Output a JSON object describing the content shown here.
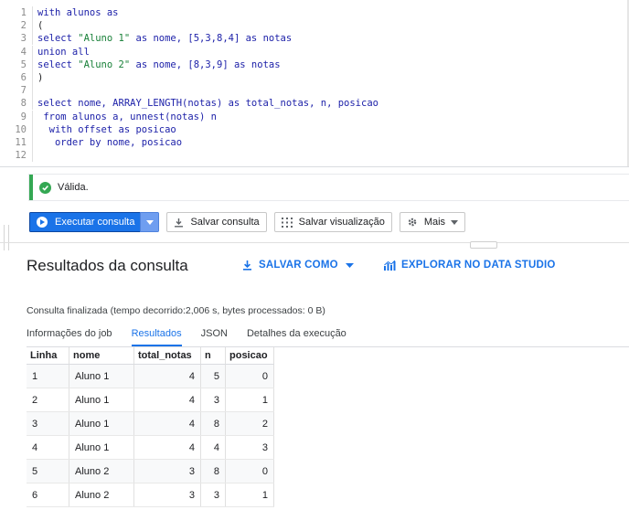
{
  "editor": {
    "lines": [
      {
        "num": "1",
        "tokens": [
          {
            "t": "with alunos as",
            "c": "kw"
          }
        ]
      },
      {
        "num": "2",
        "tokens": [
          {
            "t": "(",
            "c": "plain"
          }
        ]
      },
      {
        "num": "3",
        "tokens": [
          {
            "t": "select ",
            "c": "kw"
          },
          {
            "t": "\"Aluno 1\"",
            "c": "str"
          },
          {
            "t": " as nome, [5,3,8,4] as notas",
            "c": "kw"
          }
        ]
      },
      {
        "num": "4",
        "tokens": [
          {
            "t": "union all",
            "c": "kw"
          }
        ]
      },
      {
        "num": "5",
        "tokens": [
          {
            "t": "select ",
            "c": "kw"
          },
          {
            "t": "\"Aluno 2\"",
            "c": "str"
          },
          {
            "t": " as nome, [8,3,9] as notas",
            "c": "kw"
          }
        ]
      },
      {
        "num": "6",
        "tokens": [
          {
            "t": ")",
            "c": "plain"
          }
        ]
      },
      {
        "num": "7",
        "tokens": []
      },
      {
        "num": "8",
        "tokens": [
          {
            "t": "select nome, ARRAY_LENGTH(notas) as total_notas, n, posicao",
            "c": "kw"
          }
        ]
      },
      {
        "num": "9",
        "tokens": [
          {
            "t": " from alunos a, unnest(notas) n",
            "c": "kw"
          }
        ]
      },
      {
        "num": "10",
        "tokens": [
          {
            "t": "  with offset as posicao",
            "c": "kw"
          }
        ]
      },
      {
        "num": "11",
        "tokens": [
          {
            "t": "   order by nome, posicao",
            "c": "kw"
          }
        ]
      },
      {
        "num": "12",
        "tokens": []
      }
    ]
  },
  "validation": {
    "text": "Válida."
  },
  "toolbar": {
    "run_label": "Executar consulta",
    "save_query": "Salvar consulta",
    "save_view": "Salvar visualização",
    "more": "Mais"
  },
  "results": {
    "title": "Resultados da consulta",
    "save_as": "SALVAR COMO",
    "explore": "EXPLORAR NO DATA STUDIO",
    "status": "Consulta finalizada (tempo decorrido:2,006 s, bytes processados: 0 B)",
    "tabs": [
      "Informações do job",
      "Resultados",
      "JSON",
      "Detalhes da execução"
    ],
    "active_tab": 1,
    "columns": [
      "Linha",
      "nome",
      "total_notas",
      "n",
      "posicao"
    ],
    "rows": [
      [
        "1",
        "Aluno 1",
        "4",
        "5",
        "0"
      ],
      [
        "2",
        "Aluno 1",
        "4",
        "3",
        "1"
      ],
      [
        "3",
        "Aluno 1",
        "4",
        "8",
        "2"
      ],
      [
        "4",
        "Aluno 1",
        "4",
        "4",
        "3"
      ],
      [
        "5",
        "Aluno 2",
        "3",
        "8",
        "0"
      ],
      [
        "6",
        "Aluno 2",
        "3",
        "3",
        "1"
      ]
    ]
  },
  "colors": {
    "accent": "#1a73e8",
    "valid": "#34a853"
  }
}
